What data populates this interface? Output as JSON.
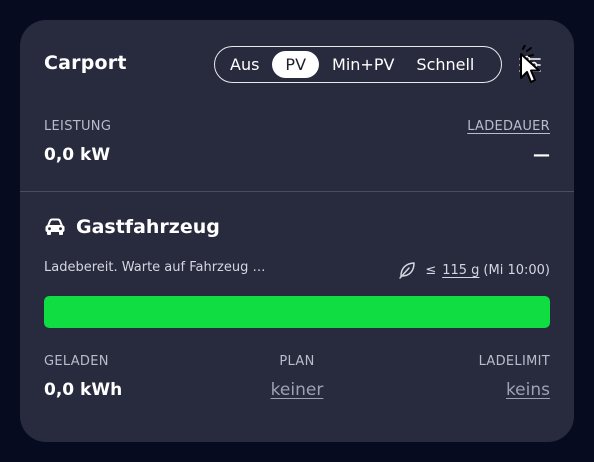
{
  "loadpoint": {
    "title": "Carport",
    "modes": [
      "Aus",
      "PV",
      "Min+PV",
      "Schnell"
    ],
    "active_mode": "PV",
    "power_label": "Leistung",
    "power_value": "0,0 kW",
    "duration_label": "Ladedauer",
    "duration_value": "—"
  },
  "vehicle": {
    "icon": "car-icon",
    "name": "Gastfahrzeug",
    "status": "Ladebereit. Warte auf Fahrzeug …",
    "co2_prefix": "≤",
    "co2_value": "115 g",
    "co2_time": "(Mi 10:00)",
    "co2_icon": "leaf-icon",
    "progress_fraction": 1.0,
    "progress_color": "#0fdd42"
  },
  "stats": {
    "charged_label": "Geladen",
    "charged_value": "0,0 kWh",
    "plan_label": "Plan",
    "plan_value": "keiner",
    "limit_label": "Ladelimit",
    "limit_value": "keins"
  },
  "colors": {
    "background": "#070b1f",
    "card": "#282b3d",
    "accent_green": "#0fdd42"
  }
}
